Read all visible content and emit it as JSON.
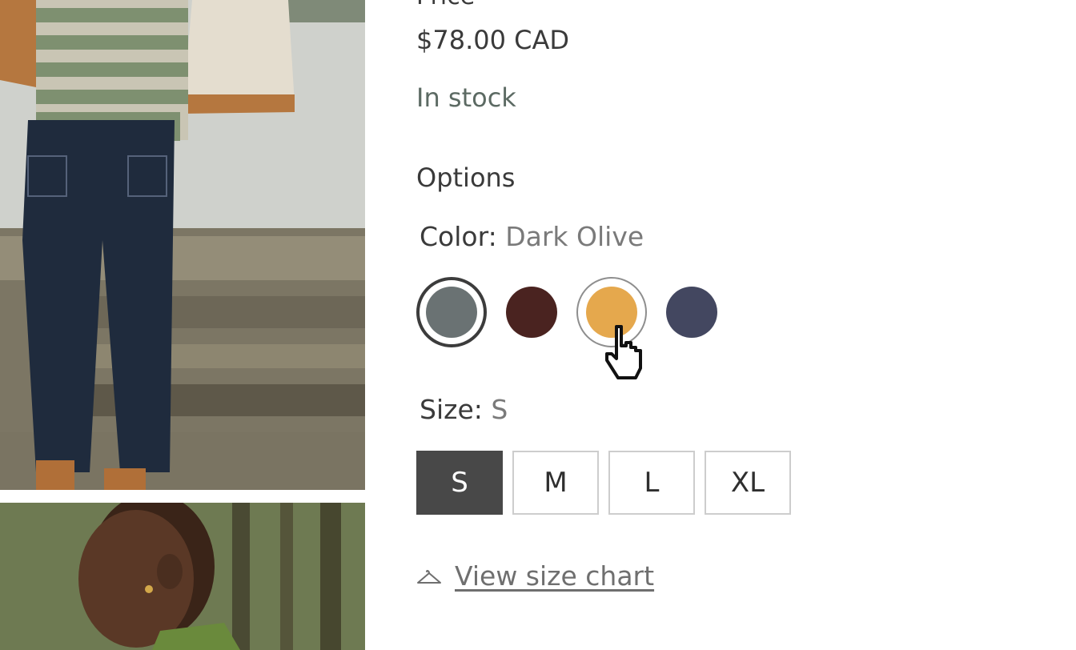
{
  "product": {
    "price_heading": "Price",
    "price_value": "$78.00 CAD",
    "stock_status": "In stock"
  },
  "options": {
    "heading": "Options",
    "color": {
      "label": "Color:",
      "value": "Dark Olive",
      "swatches": [
        {
          "color": "#6a7273",
          "state": "selected"
        },
        {
          "color": "#4a2320",
          "state": "default"
        },
        {
          "color": "#e5a84d",
          "state": "hover"
        },
        {
          "color": "#434760",
          "state": "default"
        }
      ]
    },
    "size": {
      "label": "Size:",
      "value": "S",
      "choices": [
        "S",
        "M",
        "L",
        "XL"
      ],
      "selected": "S"
    },
    "size_chart_link": "View size chart",
    "size_chart_icon": "hanger-icon"
  },
  "images": [
    {
      "depicts": "model-wearing-striped-sweater-and-jeans"
    },
    {
      "depicts": "model-portrait-in-forest"
    }
  ],
  "colors": {
    "text": "#3a3a3a",
    "stock": "#5c6a63",
    "muted": "#7a7a7a",
    "active_size_bg": "#484848",
    "size_border": "#cdcdcd"
  }
}
